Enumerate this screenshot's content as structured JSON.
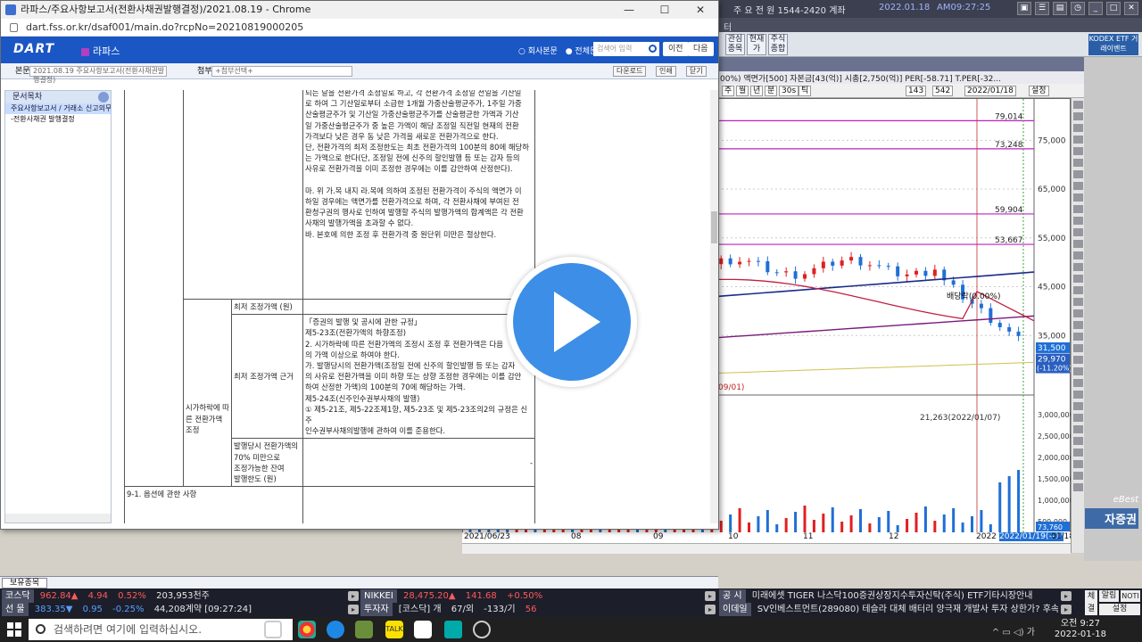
{
  "terminal": {
    "top_segments": [
      "주 요 전 원  1544-2420  계좌",
      "2022.01.18",
      "AM09:27:25"
    ],
    "menu_text": "터",
    "toolbar_buttons": [
      "관심 종목",
      "현재 가",
      "주식 종합"
    ],
    "kodex_label": "KODEX ETF 거래이벤트",
    "chart_header": "00%) 액면가[500] 자본금[43(억)] 시총[2,750(억)] PER[-58.71] T.PER[-32...",
    "chart_tools": [
      "주",
      "월",
      "년",
      "분",
      "30s",
      "틱",
      "143",
      "542",
      "2022/01/18",
      "설정"
    ],
    "ebest": "eBest",
    "broker": "자증권"
  },
  "chart_data": {
    "type": "candlestick",
    "price_ticks": [
      "75,000",
      "65,000",
      "55,000",
      "45,000",
      "35,000"
    ],
    "volume_ticks": [
      "3,000,000",
      "2,500,000",
      "2,000,000",
      "1,500,000",
      "1,000,000",
      "500,000"
    ],
    "price_lines": [
      "79,014",
      "73,248",
      "59,904",
      "53,667"
    ],
    "annotations": [
      "배당락(0.00%)",
      "21,263(2022/01/07)",
      "09/01)"
    ],
    "current_price": "31,500",
    "prev_price": "29,970",
    "change": "(-11.20%)",
    "x_labels": [
      "2021/06/23",
      "08",
      "09",
      "10",
      "11",
      "12",
      "2022",
      "2022/01/19(+1)",
      "01/18"
    ],
    "volume_last": "73,760",
    "ylim": [
      25000,
      82000
    ]
  },
  "browser": {
    "title": "라파스/주요사항보고서(전환사채권발행결정)/2021.08.19 - Chrome",
    "controls": [
      "—",
      "☐",
      "✕"
    ],
    "url": "dart.fss.or.kr/dsaf001/main.do?rcpNo=20210819000205"
  },
  "dart": {
    "logo": "DART",
    "company": "라파스",
    "radio_1": "○ 회사본문",
    "radio_2": "● 전체문서",
    "search_placeholder": "검색어 입력",
    "prev": "이전",
    "next": "다음",
    "label_main": "본문",
    "main_select": "2021.08.19  주요사항보고서(전환사채권발행결정)",
    "label_attach": "첨부",
    "attach_select": "+첨부선택+",
    "btn_download": "다운로드",
    "btn_print": "인쇄",
    "btn_close": "닫기"
  },
  "toc": {
    "title": "문서목차",
    "items": [
      "주요사항보고서 / 거래소 신고의무",
      "-전환사채권 발행결정"
    ]
  },
  "doc": {
    "para_top": [
      "되는 날을 전환가격 조정일로 하고, 각 전환가격 조정일 전일을 기산일",
      "로 하여 그 기산일로부터 소급한 1개월 가중산술평균주가, 1주일 가중",
      "산술평균주가 및 기산일 가중산술평균주가를 산술평균한 가액과 기산",
      "일 가중산술평균주가 중 높은 가액이 해당 조정일 직전일 현재의 전환",
      "가격보다 낮은 경우 동 낮은 가격을 새로운 전환가격으로 한다.",
      "단, 전환가격의 최저 조정한도는 최초 전환가격의 100분의 80에 해당하",
      "는 가액으로 한다(단, 조정일 전에 신주의 할인발행 등 또는 감자 등의",
      "사유로 전환가격을 이미 조정한 경우에는 이를 감안하여 산정한다).",
      "",
      "마. 위 가.목 내지 라.목에 의하여 조정된 전환가격이 주식의 액면가 이",
      "하일 경우에는 액면가를 전환가격으로 하며, 각 전환사채에 부여된 전",
      "환청구권의 행사로 인하여 발행할 주식의 발행가액의 합계액은 각 전환",
      "사채의 발행가액을 초과할 수 없다.",
      "바. 본호에 의한 조정 후 전환가격 중 원단위 미만은 절상한다."
    ],
    "group_label": "시가하락에 따른 전환가액 조정",
    "row1_label": "최저 조정가액 (원)",
    "row1_value": "-",
    "row2_label": "최저 조정가액 근거",
    "row2_lines": [
      "「증권의 발행 및 공시에 관한 규정」",
      "제5-23조(전환가액의 하향조정)",
      "2. 시가하락에 따른 전환가액의 조정시 조정 후 전환가액은 다음",
      "의 가액 이상으로 하여야 한다.",
      "가. 발행당시의 전환가액(조정일 전에 신주의 할인발행 등 또는 감자",
      "의 사유로 전환가액을 이미 하향 또는 상향 조정한 경우에는 이를 감안",
      "하여 산정한 가액)의 100분의 70에 해당하는 가액.",
      "제5-24조(신주인수권부사채의 발행)",
      "① 제5-21조, 제5-22조제1항, 제5-23조 및 제5-23조의2의 규정은 신주",
      "인수권부사채의발행에 관하여 이를 준용한다."
    ],
    "row3_label_lines": [
      "발행당시 전환가액의",
      "70% 미만으로",
      "조정가능한 잔여",
      "발행한도 (원)"
    ],
    "row3_value": "-",
    "section_9_1": "9-1. 옵션에 관한 사항"
  },
  "holdings_tab": "보유종목",
  "ticker": {
    "row1": [
      {
        "label": "코스닥",
        "value": "962.84▲",
        "chg": "4.94",
        "pct": "0.52%",
        "vol": "203,953천주",
        "cls": "up"
      },
      {
        "label": "NIKKEI",
        "value": "28,475.20▲",
        "chg": "141.68",
        "pct": "+0.50%",
        "vol": "",
        "cls": "up"
      },
      {
        "label": "공  시",
        "value": "미래에셋 TIGER 나스닥100증권상장지수투자신탁(주식) ETF기타시장안내",
        "chg": "",
        "pct": "",
        "vol": "",
        "cls": "w"
      }
    ],
    "row2": [
      {
        "label": "선  물",
        "value": "383.35▼",
        "chg": "0.95",
        "pct": "-0.25%",
        "vol": "44,208계약 [09:27:24]",
        "cls": "down"
      },
      {
        "label": "투자자",
        "value": "[코스닥] 개",
        "chg": "67/외",
        "pct": "-133/기",
        "vol": "56",
        "cls": "w"
      },
      {
        "label": "이데일",
        "value": "SV인베스트먼트(289080) 테슬라 대체 배터리 양극재 개발사 투자 상한가? 후속종목은 이거??",
        "chg": "",
        "pct": "",
        "vol": "",
        "cls": "w"
      }
    ],
    "right_btns": [
      "체결",
      "알림",
      "NOTI",
      "설정"
    ]
  },
  "taskbar": {
    "search_placeholder": "검색하려면 여기에 입력하십시오.",
    "time": "오전 9:27",
    "date": "2022-01-18",
    "systray": "^ ▭ ◁) 가"
  }
}
